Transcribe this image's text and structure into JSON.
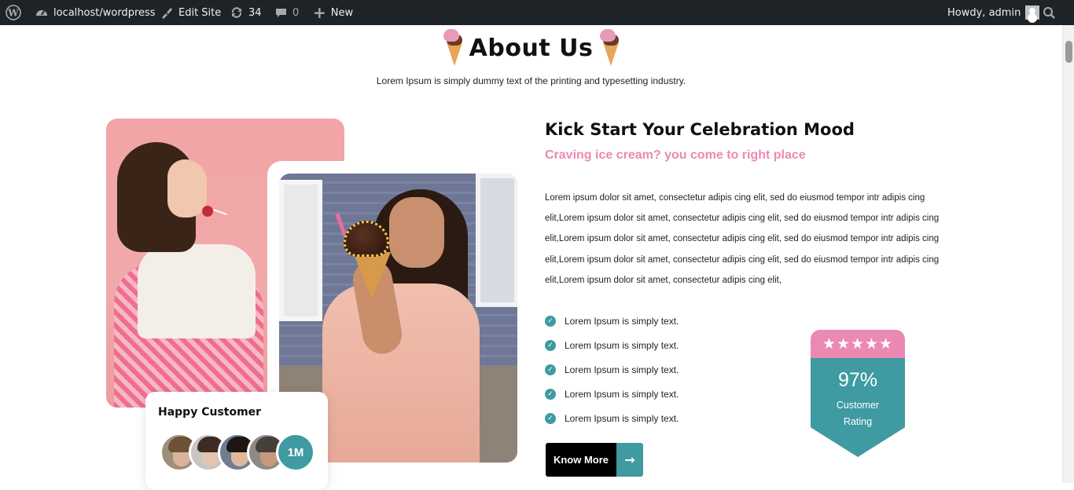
{
  "admin_bar": {
    "site_name": "localhost/wordpress",
    "edit_site": "Edit Site",
    "updates_count": "34",
    "comments_count": "0",
    "new_label": "New",
    "howdy": "Howdy, admin"
  },
  "about": {
    "title": "About Us",
    "subtitle": "Lorem Ipsum is simply dummy text of the printing and typesetting industry."
  },
  "content": {
    "heading": "Kick Start Your Celebration Mood",
    "subheading": "Craving ice cream? you come to right place",
    "paragraph": "Lorem ipsum dolor sit amet, consectetur adipis cing elit, sed do eiusmod tempor intr adipis cing elit,Lorem ipsum dolor sit amet, consectetur adipis cing elit, sed do eiusmod tempor intr adipis cing elit,Lorem ipsum dolor sit amet, consectetur adipis cing elit, sed do eiusmod tempor intr adipis cing elit,Lorem ipsum dolor sit amet, consectetur adipis cing elit, sed do eiusmod tempor intr adipis cing elit,Lorem ipsum dolor sit amet, consectetur adipis cing elit,",
    "checklist": [
      "Lorem Ipsum is simply text.",
      "Lorem Ipsum is simply text.",
      "Lorem Ipsum is simply text.",
      "Lorem Ipsum is simply text.",
      "Lorem Ipsum is simply text."
    ],
    "button_label": "Know More"
  },
  "happy_customer": {
    "title": "Happy Customer",
    "count": "1M"
  },
  "rating": {
    "stars": "★★★★★",
    "percent": "97%",
    "label_line1": "Customer",
    "label_line2": "Rating"
  },
  "colors": {
    "accent_teal": "#3f9aa2",
    "accent_pink": "#ea89b3",
    "adminbar_bg": "#1d2327"
  },
  "icons": [
    "wordpress-icon",
    "dashboard-icon",
    "brush-icon",
    "refresh-icon",
    "comment-icon",
    "plus-icon",
    "avatar-icon",
    "search-icon",
    "check-icon",
    "arrow-right-icon",
    "star-icon"
  ]
}
